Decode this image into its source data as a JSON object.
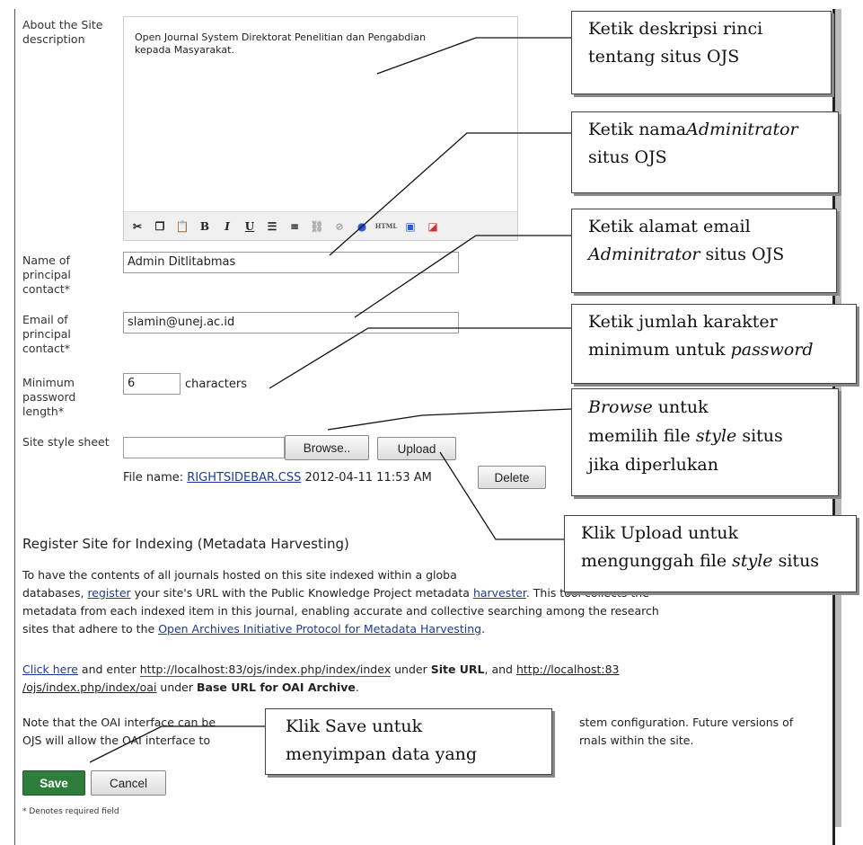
{
  "form": {
    "about_label": "About the Site description",
    "about_text": "Open Journal System Direktorat Penelitian dan Pengabdian kepada Masyarakat.",
    "name_label": "Name of principal contact*",
    "name_value": "Admin Ditlitabmas",
    "email_label": "Email of principal contact*",
    "email_value": "slamin@unej.ac.id",
    "minpw_label": "Minimum password length*",
    "minpw_value": "6",
    "minpw_unit": "characters",
    "stylesheet_label": "Site style sheet",
    "browse_label": "Browse..",
    "upload_label": "Upload",
    "file_name_label": "File name:",
    "file_name": "RIGHTSIDEBAR.CSS",
    "file_date": "2012-04-11 11:53 AM",
    "delete_label": "Delete"
  },
  "toolbar": {
    "icons": [
      "cut-icon",
      "copy-icon",
      "paste-icon",
      "bold-icon",
      "italic-icon",
      "underline-icon",
      "bullet-list-icon",
      "numbered-list-icon",
      "link-icon",
      "unlink-icon",
      "help-icon",
      "html-icon",
      "image-icon",
      "fullscreen-icon"
    ],
    "bold": "B",
    "italic": "I",
    "underline": "U",
    "html": "HTML"
  },
  "indexing": {
    "heading": "Register Site for Indexing (Metadata Harvesting)",
    "p1_a": "To have the contents of all journals hosted on this site indexed within a globa",
    "p1_b": "databases,",
    "p1_register": "register",
    "p1_c": "your site's URL with the Public Knowledge Project metadata",
    "p1_harvester": "harvester",
    "p1_d": ". This tool collects the",
    "p1_e": "metadata from each indexed item in this journal, enabling accurate and collective searching among the research",
    "p1_f": "sites that adhere to the",
    "p1_oai_link": "Open Archives Initiative Protocol for Metadata Harvesting",
    "p1_g": ".",
    "p2_click": "Click here",
    "p2_a": "and enter",
    "p2_url1": "http://localhost:83/ojs/index.php/index/index",
    "p2_b": "under",
    "p2_site_url": "Site URL",
    "p2_c": ", and",
    "p2_url2a": "http://localhost:83",
    "p2_url2b": "/ojs/index.php/index/oai",
    "p2_d": "under",
    "p2_base": "Base URL for OAI Archive",
    "p2_e": ".",
    "p3_a": "Note that the OAI interface can be",
    "p3_b": "stem configuration. Future versions of",
    "p3_c": "OJS will allow the OAI interface to",
    "p3_d": "rnals within the site."
  },
  "actions": {
    "save_label": "Save",
    "cancel_label": "Cancel",
    "required_note": "* Denotes required field"
  },
  "callouts": {
    "c1_line1": "Ketik deskripsi rinci",
    "c1_line2": "tentang situs OJS",
    "c2_line1": "Ketik nama",
    "c2_line1_em": "Adminitrator",
    "c2_line2": "situs OJS",
    "c3_line1": "Ketik alamat email",
    "c3_line2_em": "Adminitrator",
    "c3_line2": "situs OJS",
    "c4_line1": "Ketik jumlah karakter",
    "c4_line2": "minimum untuk",
    "c4_line2_em": "password",
    "c5_line1_em": "Browse",
    "c5_line1": "untuk",
    "c5_line2": "memilih file",
    "c5_line2_em": "style",
    "c5_line2b": "situs",
    "c5_line3": "jika diperlukan",
    "c6_line1": "Klik Upload untuk",
    "c6_line2": "mengunggah file",
    "c6_line2_em": "style",
    "c6_line2b": "situs",
    "c7_line1": "Klik Save untuk",
    "c7_line2": "menyimpan data yang"
  },
  "colors": {
    "save_bg": "#2f7d3c",
    "link": "#1a3a9c"
  }
}
